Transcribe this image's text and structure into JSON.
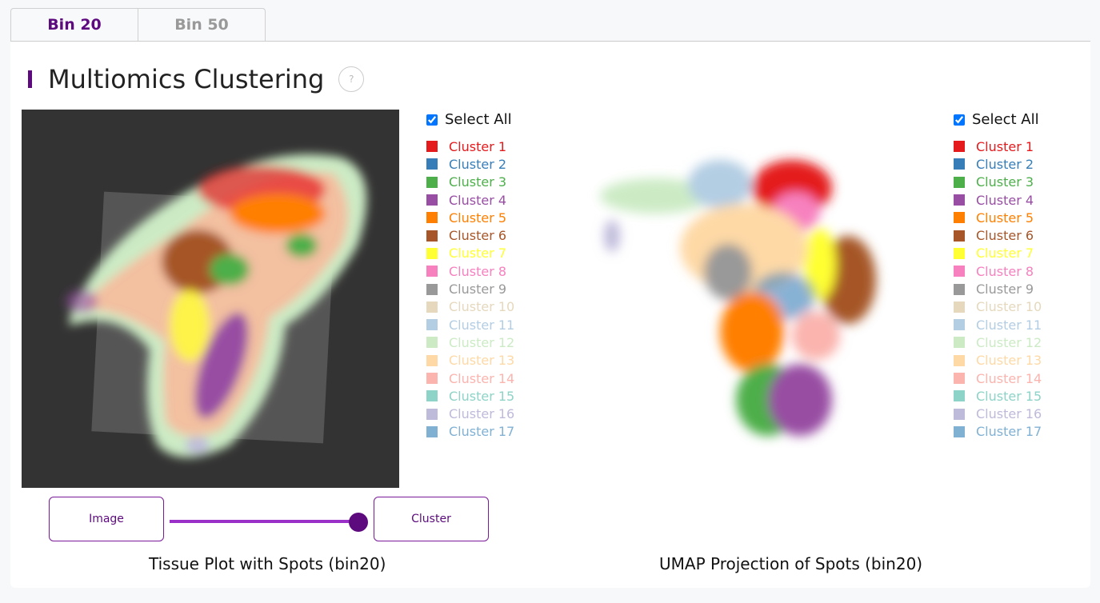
{
  "tabs": [
    {
      "label": "Bin 20"
    },
    {
      "label": "Bin 50"
    }
  ],
  "title": "Multiomics Clustering",
  "help_label": "?",
  "select_all": "Select All",
  "clusters": [
    {
      "label": "Cluster 1",
      "color": "#e41a1c"
    },
    {
      "label": "Cluster 2",
      "color": "#377eb8"
    },
    {
      "label": "Cluster 3",
      "color": "#4daf4a"
    },
    {
      "label": "Cluster 4",
      "color": "#984ea3"
    },
    {
      "label": "Cluster 5",
      "color": "#ff7f00"
    },
    {
      "label": "Cluster 6",
      "color": "#a65628"
    },
    {
      "label": "Cluster 7",
      "color": "#ffff33"
    },
    {
      "label": "Cluster 8",
      "color": "#f781bf"
    },
    {
      "label": "Cluster 9",
      "color": "#999999"
    },
    {
      "label": "Cluster 10",
      "color": "#e5d8bd"
    },
    {
      "label": "Cluster 11",
      "color": "#b3cde3"
    },
    {
      "label": "Cluster 12",
      "color": "#ccebc5"
    },
    {
      "label": "Cluster 13",
      "color": "#fed9a6"
    },
    {
      "label": "Cluster 14",
      "color": "#fbb4ae"
    },
    {
      "label": "Cluster 15",
      "color": "#8dd3c7"
    },
    {
      "label": "Cluster 16",
      "color": "#bebada"
    },
    {
      "label": "Cluster 17",
      "color": "#80b1d3"
    }
  ],
  "toggle": {
    "left": "Image",
    "right": "Cluster",
    "value": 1
  },
  "captions": {
    "tissue": "Tissue Plot with Spots (bin20)",
    "umap": "UMAP Projection of Spots (bin20)"
  }
}
